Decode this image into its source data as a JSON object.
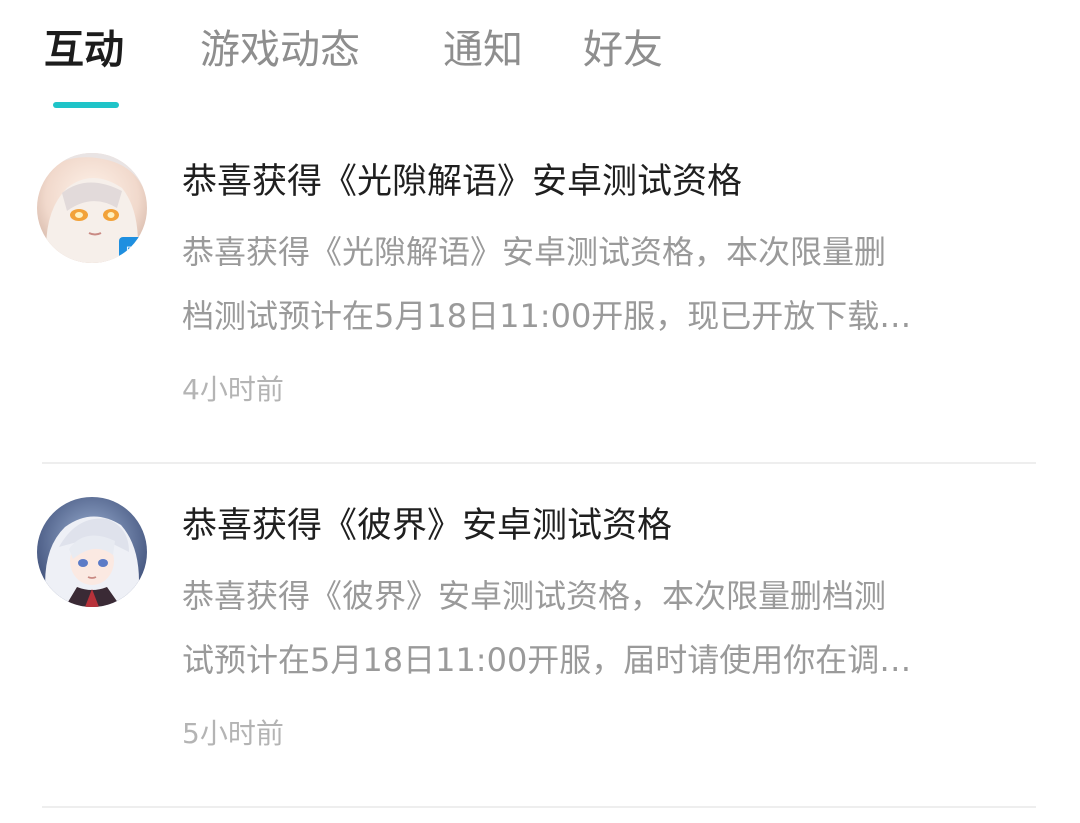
{
  "tabs": [
    {
      "label": "互动",
      "active": true
    },
    {
      "label": "游戏动态",
      "active": false
    },
    {
      "label": "通知",
      "active": false
    },
    {
      "label": "好友",
      "active": false
    }
  ],
  "accent_color": "#1fc4c8",
  "notifications": [
    {
      "avatar_icon": "anime-character-avatar",
      "title": "恭喜获得《光隙解语》安卓测试资格",
      "body_line1": "恭喜获得《光隙解语》安卓测试资格，本次限量删",
      "body_line2": "档测试预计在5月18日11:00开服，现已开放下载…",
      "time": "4小时前"
    },
    {
      "avatar_icon": "anime-character-avatar",
      "title": "恭喜获得《彼界》安卓测试资格",
      "body_line1": "恭喜获得《彼界》安卓测试资格，本次限量删档测",
      "body_line2": "试预计在5月18日11:00开服，届时请使用你在调…",
      "time": "5小时前"
    }
  ]
}
